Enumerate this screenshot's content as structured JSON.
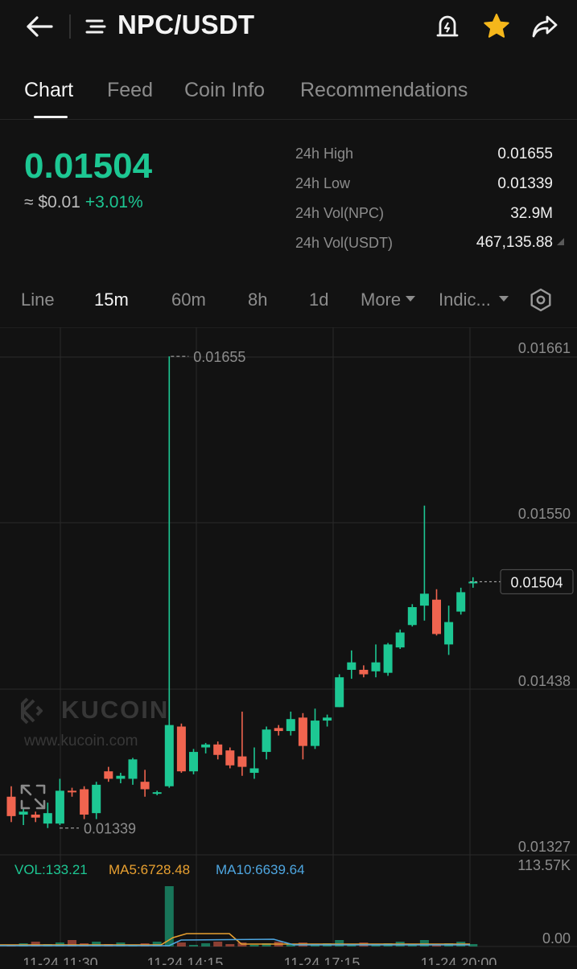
{
  "header": {
    "title": "NPC/USDT",
    "icons": [
      "back-arrow-icon",
      "menu-icon",
      "alert-icon",
      "star-icon",
      "share-icon"
    ],
    "star_color": "#f5b71b"
  },
  "tabs": [
    {
      "label": "Chart",
      "active": true
    },
    {
      "label": "Feed",
      "active": false
    },
    {
      "label": "Coin Info",
      "active": false
    },
    {
      "label": "Recommendations",
      "active": false
    }
  ],
  "price": {
    "last": "0.01504",
    "approx": "≈ $0.01",
    "change": "+3.01%",
    "color_up": "#1dc793",
    "color_down": "#f0644f"
  },
  "stats": [
    {
      "label": "24h High",
      "value": "0.01655"
    },
    {
      "label": "24h Low",
      "value": "0.01339"
    },
    {
      "label": "24h Vol(NPC)",
      "value": "32.9M"
    },
    {
      "label": "24h Vol(USDT)",
      "value": "467,135.88"
    }
  ],
  "intervals": [
    {
      "label": "Line",
      "active": false
    },
    {
      "label": "15m",
      "active": true
    },
    {
      "label": "60m",
      "active": false
    },
    {
      "label": "8h",
      "active": false
    },
    {
      "label": "1d",
      "active": false
    },
    {
      "label": "More",
      "active": false
    },
    {
      "label": "Indic...",
      "active": false
    }
  ],
  "watermark": {
    "brand": "KUCOIN",
    "url": "www.kucoin.com"
  },
  "chart_data": {
    "type": "candlestick",
    "y_ticks": [
      "0.01661",
      "0.01550",
      "0.01438",
      "0.01327"
    ],
    "ylim": [
      0.01327,
      0.01661
    ],
    "high_marker": "0.01655",
    "low_marker": "0.01339",
    "last_price_label": "0.01504",
    "x_ticks": [
      "11-24 11:30",
      "11-24 14:15",
      "11-24 17:15",
      "11-24 20:00"
    ],
    "candles": [
      {
        "o": 0.0136,
        "h": 0.01367,
        "l": 0.01343,
        "c": 0.01347
      },
      {
        "o": 0.01348,
        "h": 0.01352,
        "l": 0.01341,
        "c": 0.0135
      },
      {
        "o": 0.01348,
        "h": 0.0135,
        "l": 0.01343,
        "c": 0.01346
      },
      {
        "o": 0.01342,
        "h": 0.01356,
        "l": 0.01339,
        "c": 0.01349
      },
      {
        "o": 0.01342,
        "h": 0.01372,
        "l": 0.01341,
        "c": 0.01364
      },
      {
        "o": 0.01364,
        "h": 0.01366,
        "l": 0.0136,
        "c": 0.01363
      },
      {
        "o": 0.01365,
        "h": 0.01367,
        "l": 0.01345,
        "c": 0.01348
      },
      {
        "o": 0.01349,
        "h": 0.0137,
        "l": 0.01345,
        "c": 0.01368
      },
      {
        "o": 0.01377,
        "h": 0.0138,
        "l": 0.0137,
        "c": 0.01372
      },
      {
        "o": 0.01372,
        "h": 0.01376,
        "l": 0.01369,
        "c": 0.01374
      },
      {
        "o": 0.01372,
        "h": 0.01386,
        "l": 0.01368,
        "c": 0.01385
      },
      {
        "o": 0.0137,
        "h": 0.01378,
        "l": 0.0136,
        "c": 0.01365
      },
      {
        "o": 0.01362,
        "h": 0.01364,
        "l": 0.01361,
        "c": 0.01363
      },
      {
        "o": 0.01367,
        "h": 0.01655,
        "l": 0.01366,
        "c": 0.01408
      },
      {
        "o": 0.01407,
        "h": 0.01409,
        "l": 0.01376,
        "c": 0.01377
      },
      {
        "o": 0.01377,
        "h": 0.01392,
        "l": 0.01375,
        "c": 0.0139
      },
      {
        "o": 0.01393,
        "h": 0.01396,
        "l": 0.01389,
        "c": 0.01395
      },
      {
        "o": 0.01395,
        "h": 0.01397,
        "l": 0.01385,
        "c": 0.01388
      },
      {
        "o": 0.01391,
        "h": 0.01393,
        "l": 0.01379,
        "c": 0.01381
      },
      {
        "o": 0.01387,
        "h": 0.01417,
        "l": 0.01374,
        "c": 0.0138
      },
      {
        "o": 0.01376,
        "h": 0.01393,
        "l": 0.01372,
        "c": 0.01379
      },
      {
        "o": 0.0139,
        "h": 0.01407,
        "l": 0.01385,
        "c": 0.01405
      },
      {
        "o": 0.01406,
        "h": 0.01408,
        "l": 0.01401,
        "c": 0.01404
      },
      {
        "o": 0.01404,
        "h": 0.01417,
        "l": 0.01401,
        "c": 0.01412
      },
      {
        "o": 0.01413,
        "h": 0.01416,
        "l": 0.01385,
        "c": 0.01394
      },
      {
        "o": 0.01394,
        "h": 0.01419,
        "l": 0.01392,
        "c": 0.01411
      },
      {
        "o": 0.01411,
        "h": 0.01415,
        "l": 0.01407,
        "c": 0.01413
      },
      {
        "o": 0.0142,
        "h": 0.01442,
        "l": 0.0142,
        "c": 0.0144
      },
      {
        "o": 0.01445,
        "h": 0.01458,
        "l": 0.01439,
        "c": 0.0145
      },
      {
        "o": 0.01445,
        "h": 0.01448,
        "l": 0.0144,
        "c": 0.01442
      },
      {
        "o": 0.01444,
        "h": 0.01462,
        "l": 0.0144,
        "c": 0.0145
      },
      {
        "o": 0.01443,
        "h": 0.01463,
        "l": 0.01441,
        "c": 0.01462
      },
      {
        "o": 0.0146,
        "h": 0.01472,
        "l": 0.01459,
        "c": 0.0147
      },
      {
        "o": 0.01475,
        "h": 0.01489,
        "l": 0.01474,
        "c": 0.01487
      },
      {
        "o": 0.01488,
        "h": 0.01555,
        "l": 0.01478,
        "c": 0.01496
      },
      {
        "o": 0.01492,
        "h": 0.01499,
        "l": 0.01468,
        "c": 0.01469
      },
      {
        "o": 0.01462,
        "h": 0.01488,
        "l": 0.01455,
        "c": 0.01477
      },
      {
        "o": 0.01484,
        "h": 0.015,
        "l": 0.01482,
        "c": 0.01497
      },
      {
        "o": 0.01503,
        "h": 0.01507,
        "l": 0.015,
        "c": 0.01504
      }
    ],
    "volume": {
      "label_vol": "VOL:133.21",
      "label_ma5": "MA5:6728.48",
      "label_ma10": "MA10:6639.64",
      "max_label": "113.57K",
      "zero_label": "0.00",
      "color_vol": "#1dc793",
      "color_ma5": "#e8a030",
      "color_ma10": "#4ea6e0"
    }
  }
}
